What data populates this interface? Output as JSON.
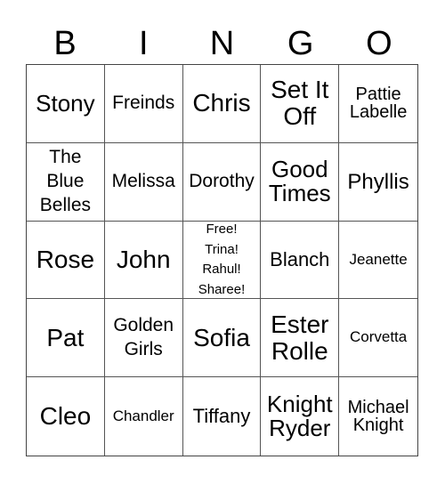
{
  "header": [
    "B",
    "I",
    "N",
    "G",
    "O"
  ],
  "cells": [
    {
      "text": "Stony",
      "size": "s27"
    },
    {
      "text": "Freinds",
      "size": "s20"
    },
    {
      "text": "Chris",
      "size": "s30"
    },
    {
      "text": "Set It\nOff",
      "size": "s30"
    },
    {
      "text": "Pattie\nLabelle",
      "size": "s19"
    },
    {
      "text": "The\nBlue\nBelles",
      "size": "s20"
    },
    {
      "text": "Melissa",
      "size": "s20"
    },
    {
      "text": "Dorothy",
      "size": "s20"
    },
    {
      "text": "Good\nTimes",
      "size": "s27"
    },
    {
      "text": "Phyllis",
      "size": "s24"
    },
    {
      "text": "Rose",
      "size": "s30"
    },
    {
      "text": "John",
      "size": "s30"
    },
    {
      "text": "Free!\nTrina!\nRahul!\nSharee!",
      "size": "s14"
    },
    {
      "text": "Blanch",
      "size": "s22"
    },
    {
      "text": "Jeanette",
      "size": "s16"
    },
    {
      "text": "Pat",
      "size": "s30"
    },
    {
      "text": "Golden\nGirls",
      "size": "s20"
    },
    {
      "text": "Sofia",
      "size": "s30"
    },
    {
      "text": "Ester\nRolle",
      "size": "s30"
    },
    {
      "text": "Corvetta",
      "size": "s16"
    },
    {
      "text": "Cleo",
      "size": "s30"
    },
    {
      "text": "Chandler",
      "size": "s16"
    },
    {
      "text": "Tiffany",
      "size": "s22"
    },
    {
      "text": "Knight\nRyder",
      "size": "s27"
    },
    {
      "text": "Michael\nKnight",
      "size": "s19"
    }
  ]
}
